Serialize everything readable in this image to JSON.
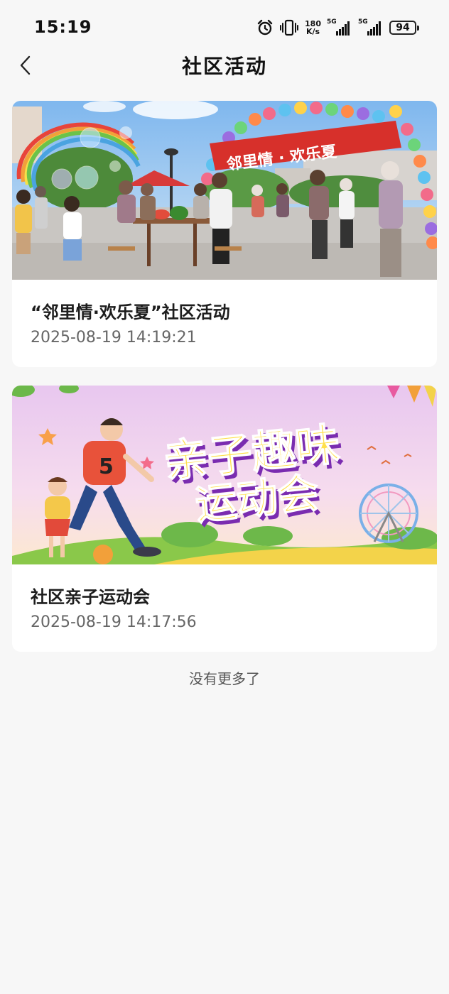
{
  "status_bar": {
    "time": "15:19",
    "net_speed_value": "180",
    "net_speed_unit": "K/s",
    "signal1_label": "5G",
    "signal2_label": "5G",
    "battery": "94"
  },
  "header": {
    "title": "社区活动"
  },
  "activities": [
    {
      "title": "“邻里情·欢乐夏”社区活动",
      "date": "2025-08-19 14:19:21",
      "banner_text": "邻里情 · 欢乐夏"
    },
    {
      "title": "社区亲子运动会",
      "date": "2025-08-19 14:17:56",
      "banner_line1": "亲子趣味",
      "banner_line2": "运动会",
      "shirt_number": "5"
    }
  ],
  "footer": {
    "no_more": "没有更多了"
  }
}
